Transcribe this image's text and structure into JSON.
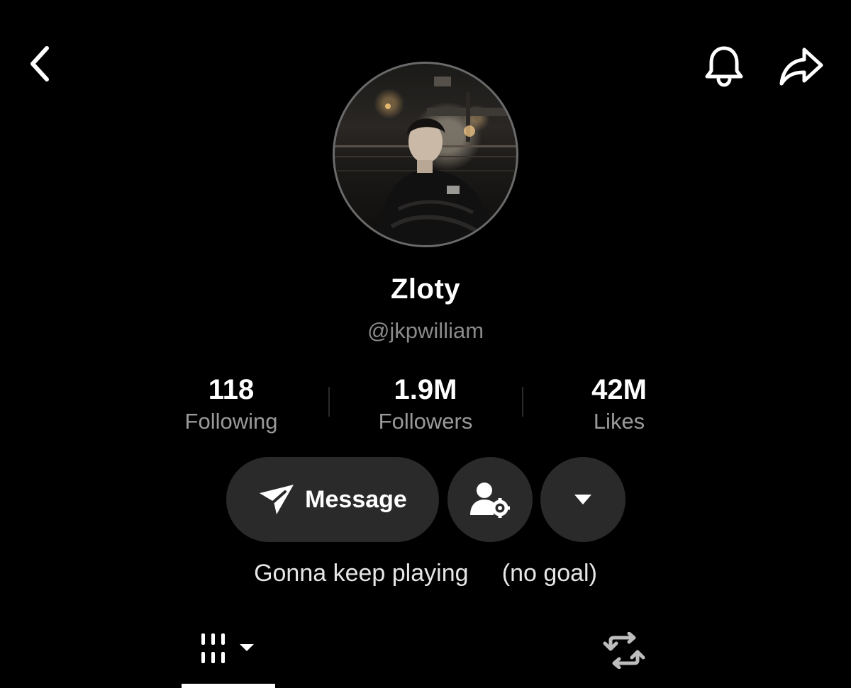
{
  "header": {
    "back_icon": "chevron-left-icon",
    "notify_icon": "bell-icon",
    "share_icon": "share-arrow-icon"
  },
  "profile": {
    "display_name": "Zloty",
    "handle": "@jkpwilliam",
    "avatar_description_icon": "avatar"
  },
  "stats": [
    {
      "value": "118",
      "label": "Following"
    },
    {
      "value": "1.9M",
      "label": "Followers"
    },
    {
      "value": "42M",
      "label": "Likes"
    }
  ],
  "actions": {
    "message_label": "Message",
    "message_icon": "send-icon",
    "friends_icon": "user-settings-icon",
    "more_icon": "caret-down-icon"
  },
  "bio": "Gonna keep playing     (no goal)",
  "tabs": [
    {
      "name": "videos",
      "icon": "grid-bars-icon",
      "has_dropdown": true,
      "active": true
    },
    {
      "name": "reposts",
      "icon": "repost-icon",
      "active": false
    }
  ],
  "colors": {
    "background": "#000000",
    "button_bg": "#2a2a2a",
    "secondary_text": "#9a9a9a",
    "primary_text": "#ffffff"
  }
}
